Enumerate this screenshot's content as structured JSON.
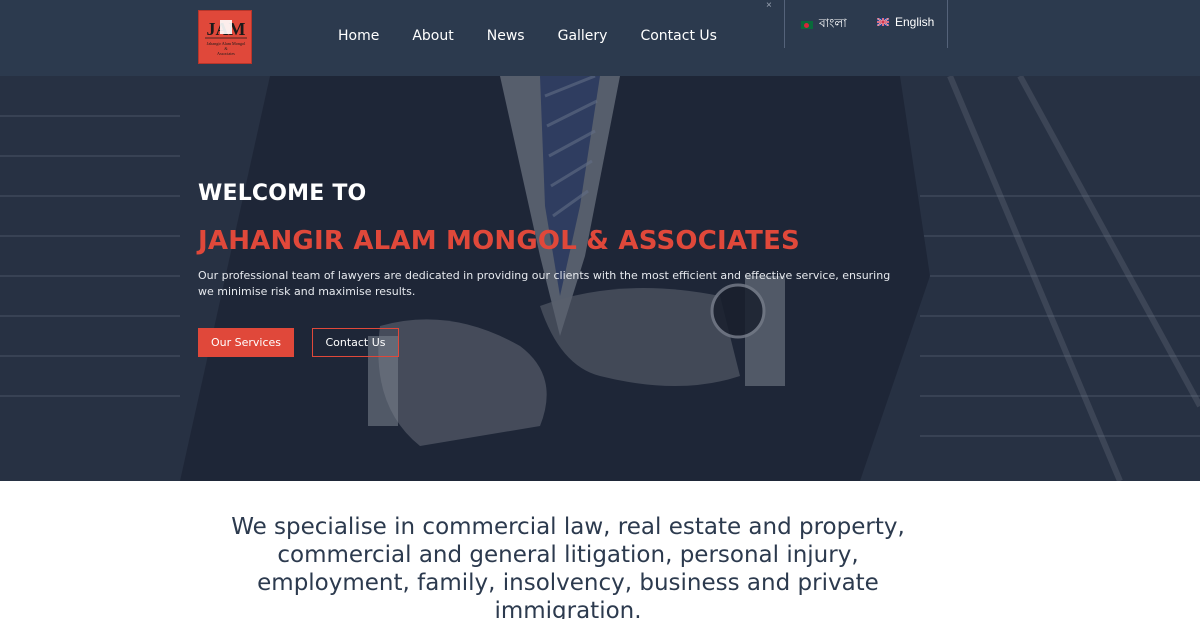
{
  "header": {
    "logo": {
      "initials": "JAM",
      "subtext": "Jahangir Alam Mongol & Associates"
    },
    "nav": [
      "Home",
      "About",
      "News",
      "Gallery",
      "Contact Us"
    ],
    "close_glyph": "×",
    "languages": [
      {
        "label": "বাংলা",
        "flag": "bangladesh-flag-icon"
      },
      {
        "label": "English",
        "flag": "uk-flag-icon"
      }
    ]
  },
  "hero": {
    "welcome": "WELCOME TO",
    "firm_name": "JAHANGIR ALAM MONGOL & ASSOCIATES",
    "description": "Our professional team of lawyers are dedicated in providing our clients with the most efficient and effective service, ensuring we minimise risk and maximise results.",
    "buttons": {
      "services": "Our Services",
      "contact": "Contact Us"
    }
  },
  "intro": {
    "text": "We specialise in commercial law, real estate and property, commercial and general litigation, personal injury, employment, family, insolvency, business and private immigration."
  },
  "colors": {
    "header_bg": "#2c3a4e",
    "accent": "#e0483a",
    "hero_overlay": "#1e283a"
  }
}
